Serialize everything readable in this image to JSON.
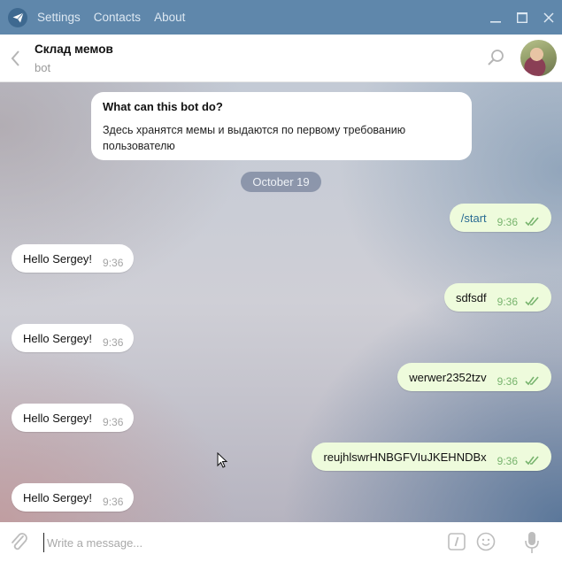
{
  "titlebar": {
    "menu": [
      {
        "label": "Settings"
      },
      {
        "label": "Contacts"
      },
      {
        "label": "About"
      }
    ],
    "icons": {
      "logo": "telegram-plane-icon",
      "minimize": "minimize-icon",
      "maximize": "maximize-icon",
      "close": "close-icon"
    }
  },
  "header": {
    "title": "Склад мемов",
    "subtitle": "bot",
    "icons": {
      "back": "chevron-left-icon",
      "search": "search-icon",
      "avatar": "avatar"
    }
  },
  "bot_info": {
    "title": "What can this bot do?",
    "text": "Здесь хранятся мемы и выдаются по первому требованию пользователю"
  },
  "date_badge": "October 19",
  "messages": [
    {
      "direction": "out",
      "text": "/start",
      "time": "9:36",
      "status": "read",
      "is_command": true
    },
    {
      "direction": "in",
      "text": "Hello Sergey!",
      "time": "9:36"
    },
    {
      "direction": "out",
      "text": "sdfsdf",
      "time": "9:36",
      "status": "read"
    },
    {
      "direction": "in",
      "text": "Hello Sergey!",
      "time": "9:36"
    },
    {
      "direction": "out",
      "text": "werwer2352tzv",
      "time": "9:36",
      "status": "read"
    },
    {
      "direction": "in",
      "text": "Hello Sergey!",
      "time": "9:36"
    },
    {
      "direction": "out",
      "text": "reujhlswrHNBGFVIuJKEHNDBx",
      "time": "9:36",
      "status": "read"
    },
    {
      "direction": "in",
      "text": "Hello Sergey!",
      "time": "9:36"
    }
  ],
  "composer": {
    "placeholder": "Write a message...",
    "value": "",
    "icons": {
      "attach": "paperclip-icon",
      "commands": "bot-command-icon",
      "emoji": "emoji-icon",
      "voice": "microphone-icon"
    }
  },
  "colors": {
    "titlebar": "#5f87ab",
    "outgoing_bubble": "#eefbdc",
    "incoming_bubble": "#ffffff",
    "read_ticks": "#78b46e",
    "command_link": "#2a6c93"
  }
}
